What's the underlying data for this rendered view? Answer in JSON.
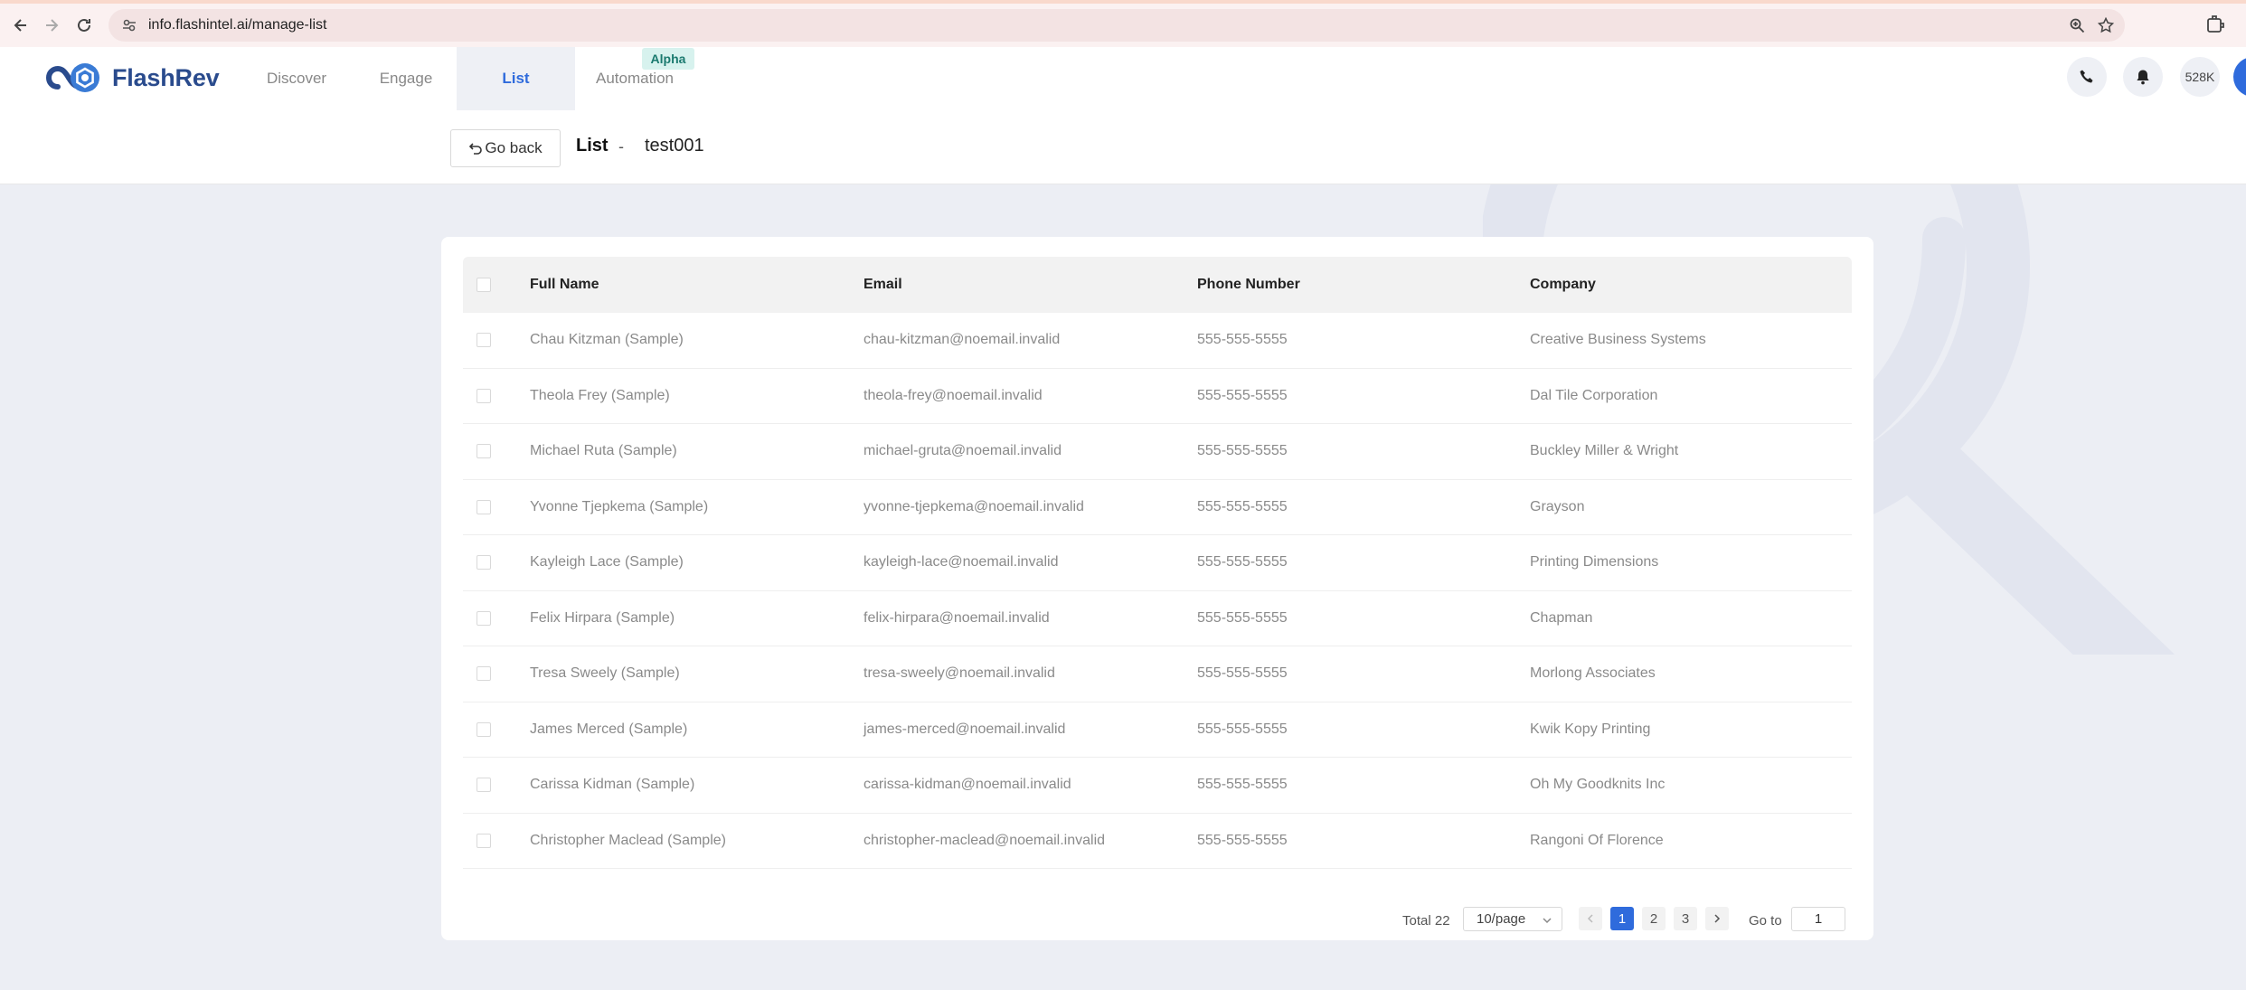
{
  "browser": {
    "url": "info.flashintel.ai/manage-list"
  },
  "header": {
    "brand": "FlashRev",
    "tabs": [
      {
        "label": "Discover",
        "active": false
      },
      {
        "label": "Engage",
        "active": false
      },
      {
        "label": "List",
        "active": true
      },
      {
        "label": "Automation",
        "active": false
      }
    ],
    "badge": "Alpha",
    "credits": "528K"
  },
  "subheader": {
    "go_back_label": "Go back",
    "section": "List",
    "separator": "-",
    "list_name": "test001"
  },
  "table": {
    "columns": [
      "Full Name",
      "Email",
      "Phone Number",
      "Company"
    ],
    "rows": [
      {
        "name": "Chau Kitzman (Sample)",
        "email": "chau-kitzman@noemail.invalid",
        "phone": "555-555-5555",
        "company": "Creative Business Systems"
      },
      {
        "name": "Theola Frey (Sample)",
        "email": "theola-frey@noemail.invalid",
        "phone": "555-555-5555",
        "company": "Dal Tile Corporation"
      },
      {
        "name": "Michael Ruta (Sample)",
        "email": "michael-gruta@noemail.invalid",
        "phone": "555-555-5555",
        "company": "Buckley Miller & Wright"
      },
      {
        "name": "Yvonne Tjepkema (Sample)",
        "email": "yvonne-tjepkema@noemail.invalid",
        "phone": "555-555-5555",
        "company": "Grayson"
      },
      {
        "name": "Kayleigh Lace (Sample)",
        "email": "kayleigh-lace@noemail.invalid",
        "phone": "555-555-5555",
        "company": "Printing Dimensions"
      },
      {
        "name": "Felix Hirpara (Sample)",
        "email": "felix-hirpara@noemail.invalid",
        "phone": "555-555-5555",
        "company": "Chapman"
      },
      {
        "name": "Tresa Sweely (Sample)",
        "email": "tresa-sweely@noemail.invalid",
        "phone": "555-555-5555",
        "company": "Morlong Associates"
      },
      {
        "name": "James Merced (Sample)",
        "email": "james-merced@noemail.invalid",
        "phone": "555-555-5555",
        "company": "Kwik Kopy Printing"
      },
      {
        "name": "Carissa Kidman (Sample)",
        "email": "carissa-kidman@noemail.invalid",
        "phone": "555-555-5555",
        "company": "Oh My Goodknits Inc"
      },
      {
        "name": "Christopher Maclead (Sample)",
        "email": "christopher-maclead@noemail.invalid",
        "phone": "555-555-5555",
        "company": "Rangoni Of Florence"
      }
    ]
  },
  "pagination": {
    "total_label": "Total 22",
    "page_size": "10/page",
    "pages": [
      "1",
      "2",
      "3"
    ],
    "current_page": "1",
    "goto_label": "Go to",
    "goto_value": "1"
  },
  "colors": {
    "accent": "#2f6bdc",
    "brand": "#2a4b8d",
    "badge_bg": "#d7f2ee",
    "page_bg": "#eceef4"
  }
}
